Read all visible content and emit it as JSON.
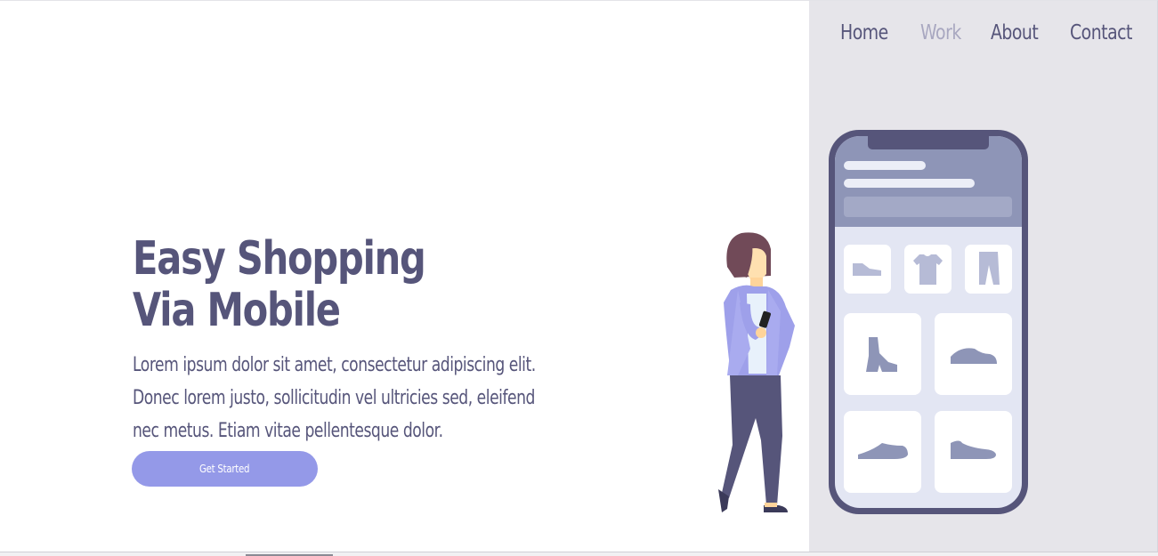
{
  "nav": {
    "items": [
      {
        "label": "Home",
        "active": false
      },
      {
        "label": "Work",
        "active": true
      },
      {
        "label": "About",
        "active": false
      },
      {
        "label": "Contact",
        "active": false
      }
    ]
  },
  "hero": {
    "title_line1": "Easy Shopping",
    "title_line2": "Via Mobile",
    "body": "Lorem ipsum dolor sit amet, consectetur adipiscing elit. Donec lorem justo, sollicitudin vel ultricies sed, eleifend nec metus. Etiam vitae pellentesque dolor.",
    "cta_label": "Get Started"
  },
  "colors": {
    "text": "#56557a",
    "nav_active": "#a8a7c0",
    "accent": "#9499e8",
    "panel": "#e6e5ea",
    "phone_frame": "#56557a",
    "phone_header": "#8e95b7"
  },
  "illustration": {
    "icons": [
      "shoe-flat-icon",
      "tshirt-icon",
      "pants-icon",
      "boot-icon",
      "sneaker-icon",
      "sneaker-icon",
      "sneaker-icon"
    ]
  }
}
